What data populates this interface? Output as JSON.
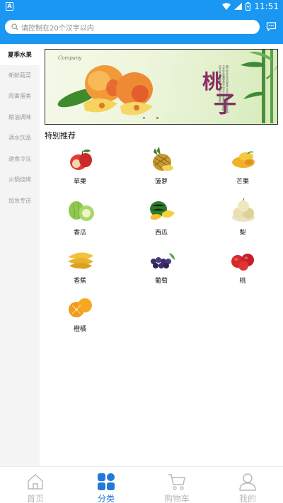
{
  "status_bar": {
    "time": "11:51"
  },
  "search": {
    "placeholder": "请控制在20个汉字以内"
  },
  "sidebar": {
    "items": [
      {
        "label": "夏季水果",
        "active": true
      },
      {
        "label": "新鲜蔬菜",
        "active": false
      },
      {
        "label": "肉禽蛋类",
        "active": false
      },
      {
        "label": "粮油调味",
        "active": false
      },
      {
        "label": "酒水饮品",
        "active": false
      },
      {
        "label": "速食冷冻",
        "active": false
      },
      {
        "label": "火锅烧烤",
        "active": false
      },
      {
        "label": "加急专送",
        "active": false
      }
    ]
  },
  "banner": {
    "company": "Company",
    "title_chars": [
      "桃",
      "子"
    ],
    "poem": "桃之夭夭灼灼其华之子于归宜其室家桃之夭夭有蕡其实之子于归宜其家室桃之夭夭其叶蓁蓁之子于归宜其家人",
    "slides": 2,
    "active_slide": 2
  },
  "section": {
    "title": "特别推荐"
  },
  "fruits": [
    {
      "label": "苹果",
      "icon": "apple-icon"
    },
    {
      "label": "菠萝",
      "icon": "pineapple-icon"
    },
    {
      "label": "芒果",
      "icon": "mango-icon"
    },
    {
      "label": "香瓜",
      "icon": "melon-icon"
    },
    {
      "label": "西瓜",
      "icon": "watermelon-icon"
    },
    {
      "label": "梨",
      "icon": "pear-icon"
    },
    {
      "label": "香蕉",
      "icon": "banana-icon"
    },
    {
      "label": "葡萄",
      "icon": "grape-icon"
    },
    {
      "label": "桃",
      "icon": "peach-icon"
    },
    {
      "label": "橙橘",
      "icon": "orange-icon"
    }
  ],
  "tabs": [
    {
      "label": "首页",
      "icon": "home-icon",
      "active": false
    },
    {
      "label": "分类",
      "icon": "category-icon",
      "active": true
    },
    {
      "label": "购物车",
      "icon": "cart-icon",
      "active": false
    },
    {
      "label": "我的",
      "icon": "user-icon",
      "active": false
    }
  ],
  "colors": {
    "primary": "#1a96f3",
    "tab_active": "#2478d8",
    "tab_inactive": "#b9b9b9",
    "sidebar_bg": "#f4f4f4"
  }
}
